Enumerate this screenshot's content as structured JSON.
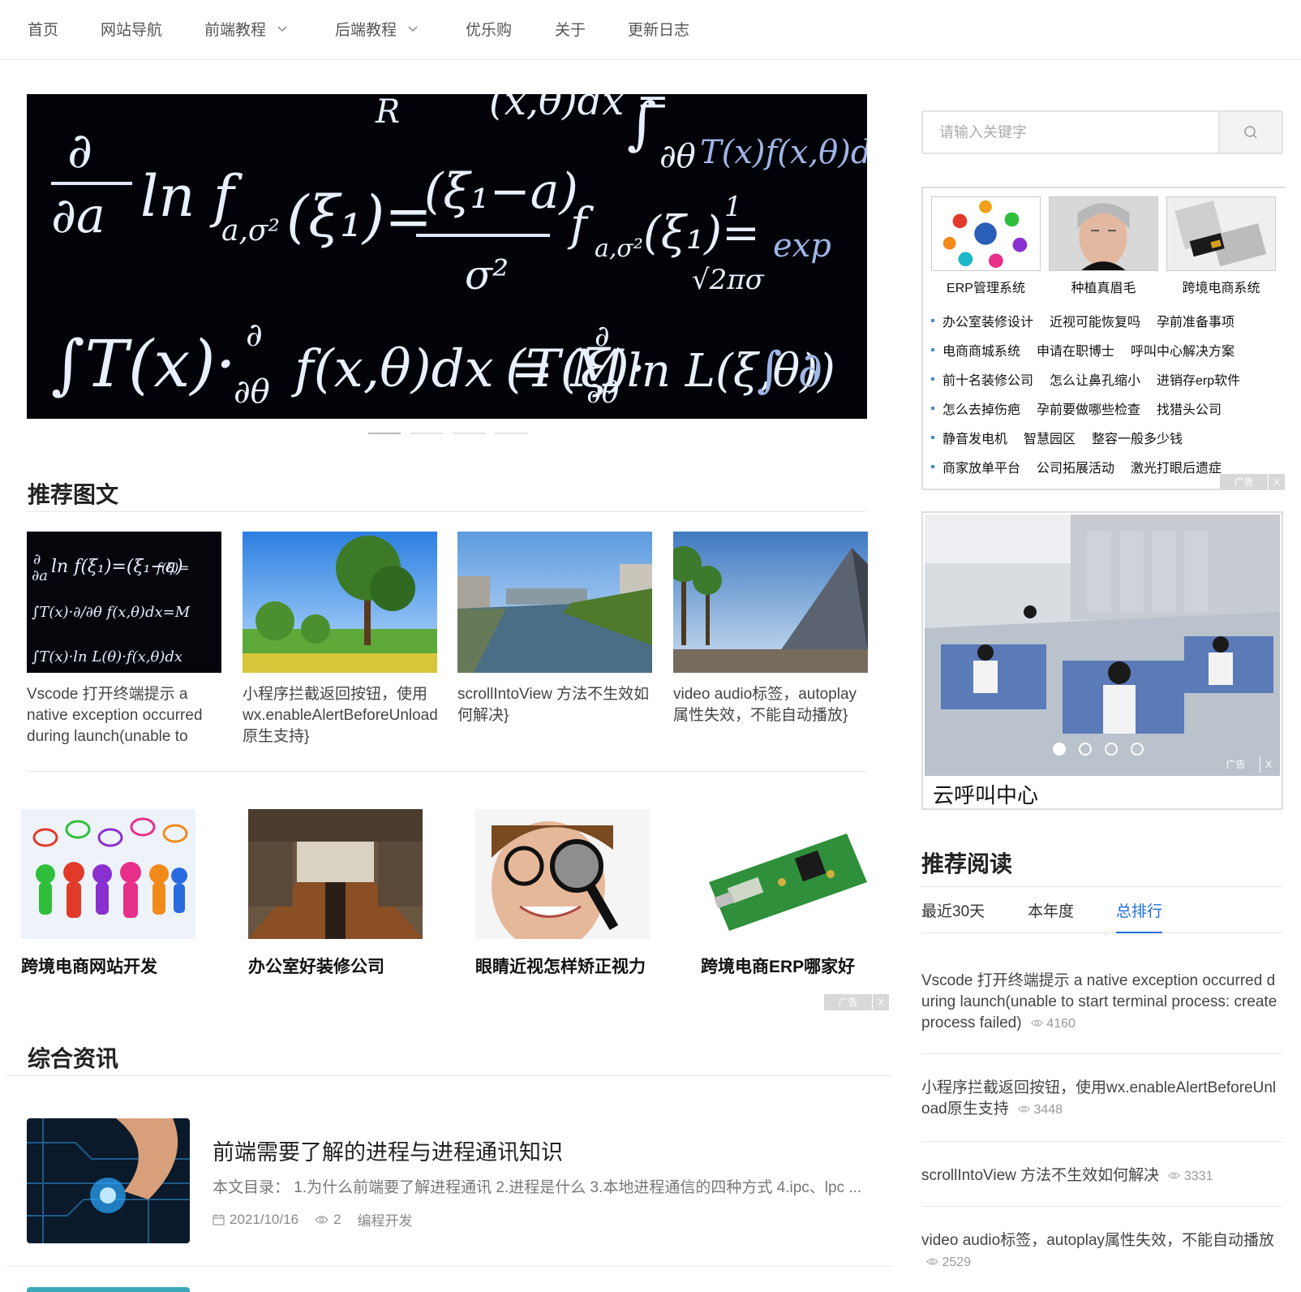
{
  "nav": {
    "items": [
      {
        "label": "首页",
        "has_dropdown": false
      },
      {
        "label": "网站导航",
        "has_dropdown": false
      },
      {
        "label": "前端教程",
        "has_dropdown": true
      },
      {
        "label": "后端教程",
        "has_dropdown": true
      },
      {
        "label": "优乐购",
        "has_dropdown": false
      },
      {
        "label": "关于",
        "has_dropdown": false
      },
      {
        "label": "更新日志",
        "has_dropdown": false
      }
    ]
  },
  "carousel": {
    "slide_count": 4,
    "active_index": 0
  },
  "recommended": {
    "title": "推荐图文",
    "cards": [
      {
        "title": "Vscode 打开终端提示 a native exception occurred during launch(unable to"
      },
      {
        "title": "小程序拦截返回按钮，使用wx.enableAlertBeforeUnload原生支持}"
      },
      {
        "title": "scrollIntoView 方法不生效如何解决}"
      },
      {
        "title": "video audio标签，autoplay属性失效，不能自动播放}"
      }
    ]
  },
  "ad_row": {
    "items": [
      {
        "title": "跨境电商网站开发"
      },
      {
        "title": "办公室好装修公司"
      },
      {
        "title": "眼睛近视怎样矫正视力"
      },
      {
        "title": "跨境电商ERP哪家好"
      }
    ],
    "ad_label": "广告",
    "close_label": "X"
  },
  "news": {
    "title": "综合资讯",
    "items": [
      {
        "title": "前端需要了解的进程与进程通讯知识",
        "summary": "本文目录：  1.为什么前端要了解进程通讯 2.进程是什么 3.本地进程通信的四种方式 4.ipc、lpc ...",
        "date": "2021/10/16",
        "views": "2",
        "category": "编程开发"
      }
    ]
  },
  "sidebar": {
    "search": {
      "placeholder": "请输入关键字",
      "value": ""
    },
    "ad_box": {
      "images": [
        {
          "caption": "ERP管理系统"
        },
        {
          "caption": "种植真眉毛"
        },
        {
          "caption": "跨境电商系统"
        }
      ],
      "rows": [
        [
          "办公室装修设计",
          "近视可能恢复吗",
          "孕前准备事项"
        ],
        [
          "电商商城系统",
          "申请在职博士",
          "呼叫中心解决方案"
        ],
        [
          "前十名装修公司",
          "怎么让鼻孔缩小",
          "进销存erp软件"
        ],
        [
          "怎么去掉伤疤",
          "孕前要做哪些检查",
          "找猎头公司"
        ],
        [
          "静音发电机",
          "智慧园区",
          "整容一般多少钱"
        ],
        [
          "商家放单平台",
          "公司拓展活动",
          "激光打眼后遗症"
        ]
      ],
      "ad_label": "广告",
      "close_label": "X"
    },
    "ad_box2": {
      "caption": "云呼叫中心",
      "dot_count": 4,
      "active_dot": 0,
      "ad_label": "广告",
      "close_label": "X"
    },
    "reading": {
      "title": "推荐阅读",
      "tabs": [
        {
          "label": "最近30天",
          "active": false
        },
        {
          "label": "本年度",
          "active": false
        },
        {
          "label": "总排行",
          "active": true
        }
      ],
      "items": [
        {
          "title": "Vscode 打开终端提示 a native exception occurred during launch(unable to start terminal process: createprocess failed)",
          "views": "4160"
        },
        {
          "title": "小程序拦截返回按钮，使用wx.enableAlertBeforeUnload原生支持",
          "views": "3448"
        },
        {
          "title": "scrollIntoView 方法不生效如何解决",
          "views": "3331"
        },
        {
          "title": "video audio标签，autoplay属性失效，不能自动播放",
          "views": "2529"
        }
      ]
    }
  },
  "colors": {
    "accent": "#1e6fd9",
    "text": "#333333",
    "muted": "#888888",
    "ad_dot": "#4a8cc7"
  },
  "icons": {
    "search": "search-icon",
    "eye": "eye-icon",
    "calendar": "calendar-icon",
    "chevron": "chevron-down-icon",
    "ad_mark": "ad-mark-icon"
  }
}
